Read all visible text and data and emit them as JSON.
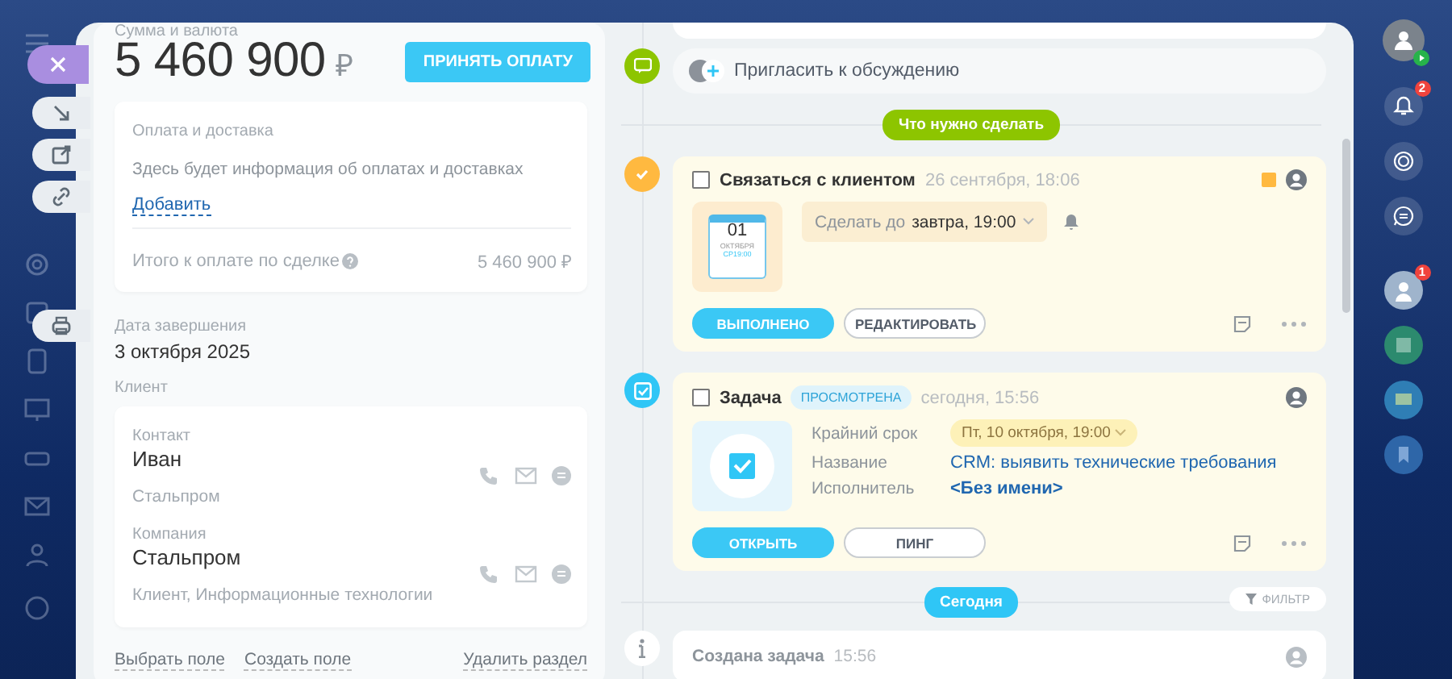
{
  "deal": {
    "amount_label": "Сумма и валюта",
    "amount": "5 460 900",
    "currency": "₽",
    "pay_button": "ПРИНЯТЬ ОПЛАТУ",
    "payment": {
      "title": "Оплата и доставка",
      "info": "Здесь будет информация об оплатах и доставках",
      "add_link": "Добавить",
      "total_label": "Итого к оплате по сделке",
      "total": "5 460 900 ₽"
    },
    "close_date": {
      "label": "Дата завершения",
      "value": "3 октября 2025"
    },
    "client": {
      "label": "Клиент",
      "entries": [
        {
          "label": "Контакт",
          "name": "Иван",
          "details": "Стальпром"
        },
        {
          "label": "Компания",
          "name": "Стальпром",
          "details": "Клиент, Информационные технологии"
        }
      ]
    },
    "field_links": [
      "Выбрать поле",
      "Создать поле"
    ],
    "delete_link": "Удалить раздел"
  },
  "timeline": {
    "invite": "Пригласить к обсуждению",
    "todo_divider": "Что нужно сделать",
    "activities": [
      {
        "kind": "call",
        "checked": false,
        "title": "Связаться с клиентом",
        "time": "26 сентября, 18:06",
        "deadline_prefix": "Сделать до",
        "deadline": "завтра, 19:00",
        "calendar": {
          "day": "01",
          "month": "ОКТЯБРЯ",
          "weekday_time": "СР19:00"
        },
        "buttons": [
          "ВЫПОЛНЕНО",
          "РЕДАКТИРОВАТЬ"
        ]
      },
      {
        "kind": "task",
        "checked": false,
        "title": "Задача",
        "status": "ПРОСМОТРЕНА",
        "time": "сегодня, 15:56",
        "fields": [
          {
            "kind": "date",
            "label": "Крайний срок",
            "value": "Пт, 10 октября, 19:00"
          },
          {
            "kind": "link",
            "label": "Название",
            "value": "CRM: выявить технические требования"
          },
          {
            "kind": "person",
            "label": "Исполнитель",
            "value": "<Без имени>"
          }
        ],
        "buttons": [
          "ОТКРЫТЬ",
          "ПИНГ"
        ]
      }
    ],
    "today_divider": "Сегодня",
    "filter": "ФИЛЬТР",
    "history": [
      {
        "title": "Создана задача",
        "time": "15:56"
      }
    ]
  },
  "right_bar": {
    "notifications_count": "2",
    "chat_count": "1"
  }
}
